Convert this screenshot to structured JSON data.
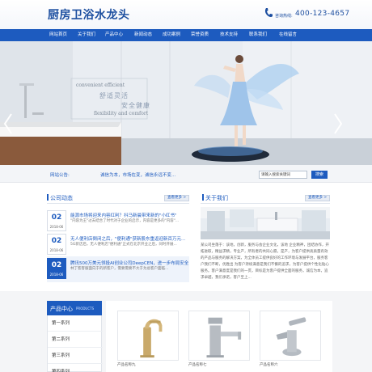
{
  "header": {
    "logo_text": "厨房卫浴水龙头",
    "hotline_label": "咨询热线:",
    "hotline_number": "400-123-4657"
  },
  "nav": {
    "items": [
      "网站首页",
      "关于我们",
      "产品中心",
      "新闻动态",
      "成功案例",
      "荣誉资质",
      "技术支持",
      "联系我们",
      "在线留言"
    ]
  },
  "banner": {
    "slogan_en_1": "convenient efficient",
    "slogan_cn_1": "舒适灵活",
    "slogan_cn_2": "安全健康",
    "slogan_en_2": "flexibility and comfort"
  },
  "searchbar": {
    "notice_label": "网站公告:",
    "notice_text": "诚信为本，市场在变，诚信永远不变...",
    "search_value": "请输入搜索关键词",
    "search_button": "搜索"
  },
  "news": {
    "title": "公司动态",
    "more": "查看更多 >",
    "items": [
      {
        "day": "02",
        "ym": "2018-06",
        "title": "能源市场将迎来内容红利？抖马新晨带来新的\"小红书\"",
        "desc": "\"内容为王\"过去结合了时代对于企业的启示，内容是更多的\"内容\"..."
      },
      {
        "day": "02",
        "ym": "2018-06",
        "title": "无人便利店倒闭之后，\"便利通\"获新股东重返迎新百万元...",
        "desc": "5G新店后，无人便利店\"便利通\"正式在北京开业之后，同时开展..."
      },
      {
        "day": "02",
        "ym": "2018-06",
        "title": "腾讯500万美元领投AI创业公司DeepCEN，进一步布局安全AI",
        "desc": "林丁客客服面向于的新客户，需要需要不大于为总客户面临..."
      }
    ]
  },
  "about": {
    "title": "关于我们",
    "more": "查看更多 >",
    "text": "某公司坐落于：该地，创新，服务与会企业文化，该地 企业精神，团结协作，开拓进取，精益求精，专业产，所有者的共同心愿。是产，为客户提供高质量有效的产品与服务的解决方案，为全体员工提供良好的工作环境与发展平台，服务客户我们不断，优胜出 为客户持续满意是我们不懈的追求，为客户提供个性化贴心服务。客户满意度是我们的一贯，目标是为客户提供全面的服务，诚信为本，追求卓越，我们承诺，客户至上..."
  },
  "products": {
    "nav_title": "产品中心",
    "nav_sub": "PRODUCTS",
    "nav_items": [
      "第一系列",
      "第二系列",
      "第三系列",
      "第四系列"
    ],
    "items": [
      {
        "name": "产品名称九"
      },
      {
        "name": "产品名称七"
      },
      {
        "name": "产品名称六"
      }
    ]
  }
}
